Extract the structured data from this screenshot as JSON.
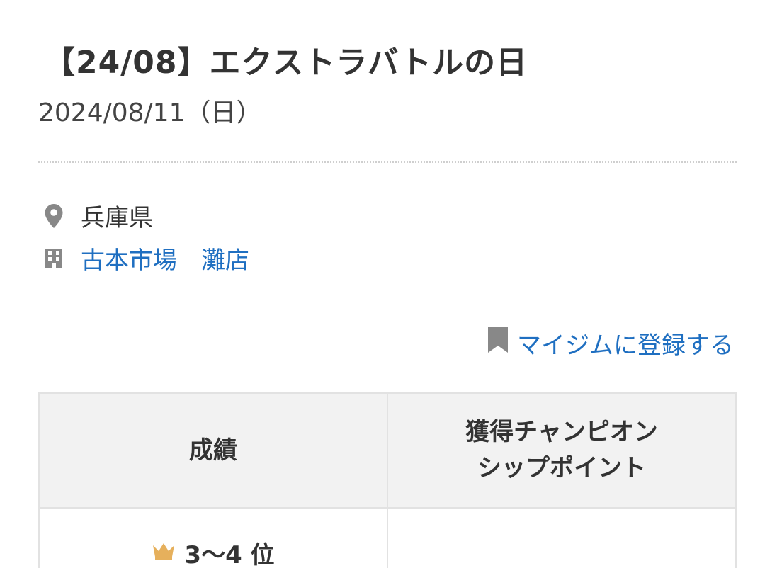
{
  "event": {
    "title": "【24/08】エクストラバトルの日",
    "date": "2024/08/11（日）"
  },
  "location": {
    "prefecture": "兵庫県",
    "prefecture_icon": "location-pin-icon",
    "store_name": "古本市場　灘店",
    "store_icon": "building-icon"
  },
  "mygym": {
    "label": "マイジムに登録する",
    "icon": "bookmark-icon"
  },
  "results_table": {
    "headers": [
      "成績",
      "獲得チャンピオン\nシップポイント"
    ],
    "rows": [
      {
        "rank": "3〜4 位",
        "rank_icon": "crown-icon",
        "points": ""
      }
    ]
  },
  "colors": {
    "link": "#1f6fc1",
    "crown": "#e6b05c",
    "icon_gray": "#888888",
    "header_bg": "#f2f2f2"
  }
}
